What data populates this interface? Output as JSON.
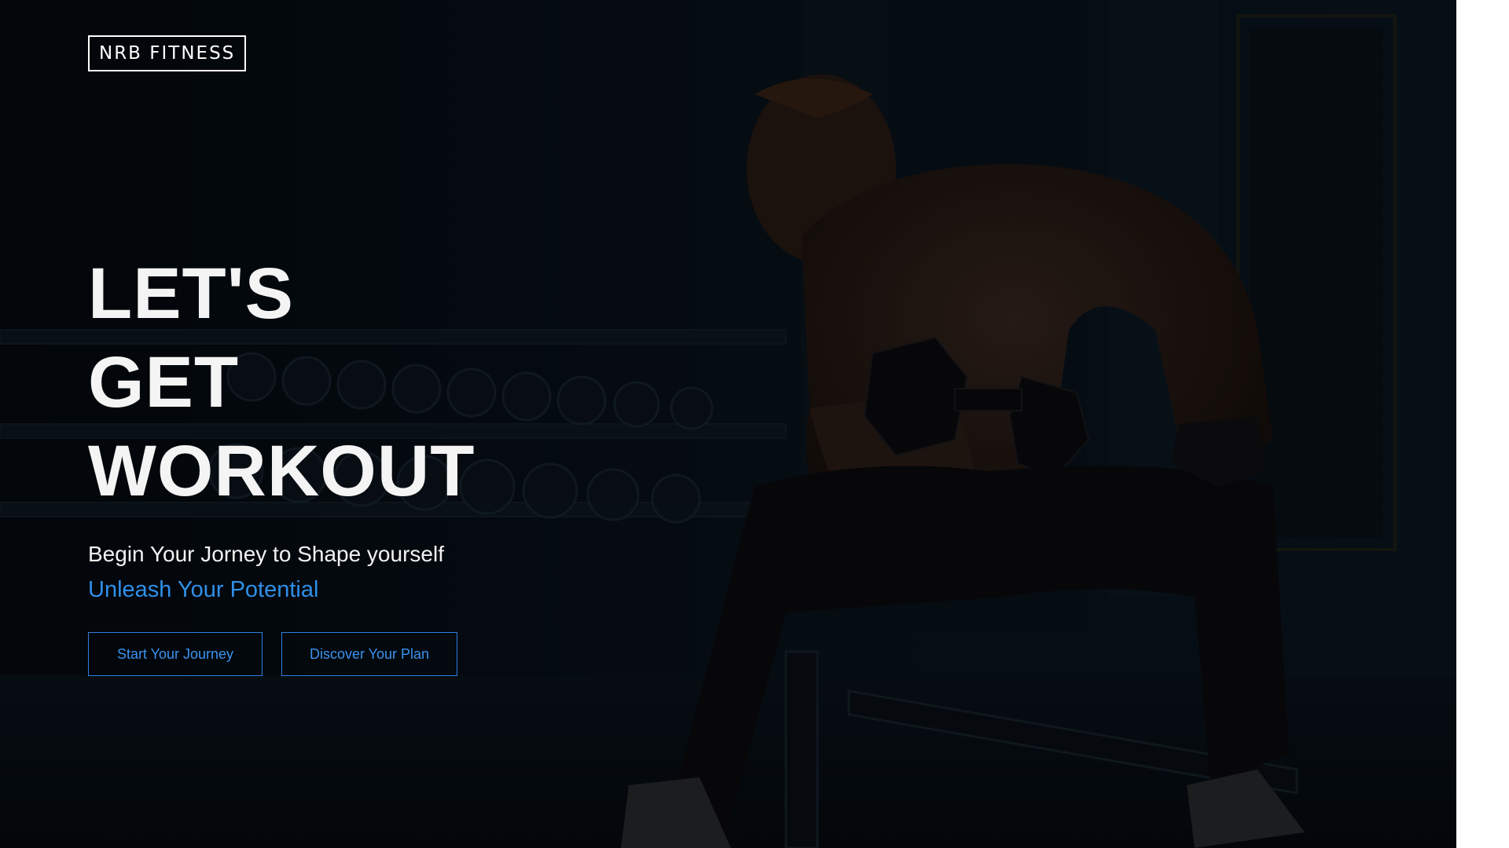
{
  "brand": {
    "logo_text": "NRB FITNESS"
  },
  "hero": {
    "headline_lines": [
      "LET'S",
      "GET",
      "WORKOUT"
    ],
    "tagline": "Begin Your Jorney to Shape yourself",
    "subtagline": "Unleash Your Potential",
    "primary_button": "Start Your Journey",
    "secondary_button": "Discover Your Plan"
  },
  "colors": {
    "background": "#05080d",
    "accent": "#2f8fe8",
    "text": "#ffffff"
  }
}
